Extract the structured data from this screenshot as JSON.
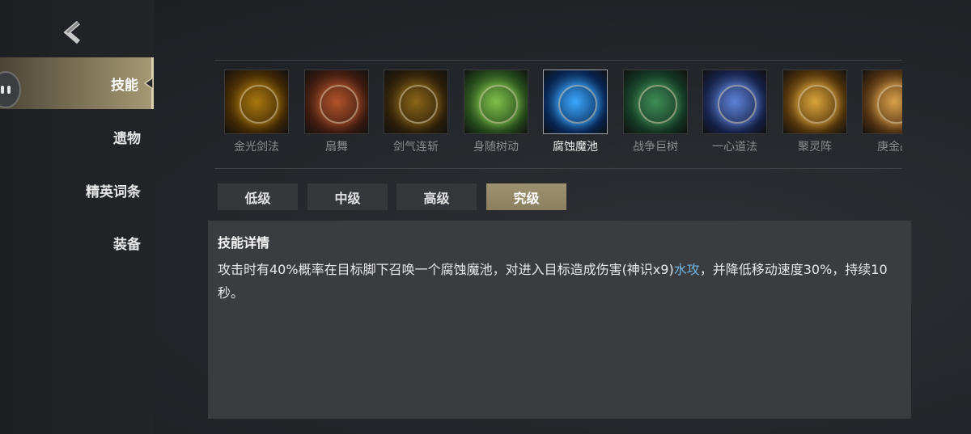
{
  "sidebar": {
    "items": [
      {
        "label": "技能",
        "active": true
      },
      {
        "label": "遗物",
        "active": false
      },
      {
        "label": "精英词条",
        "active": false
      },
      {
        "label": "装备",
        "active": false
      }
    ]
  },
  "skills": [
    {
      "name": "金光剑法",
      "selected": false,
      "colors": [
        "#a8780e",
        "#3b2406"
      ]
    },
    {
      "name": "扇舞",
      "selected": false,
      "colors": [
        "#b2532a",
        "#3a1a10"
      ]
    },
    {
      "name": "剑气连斩",
      "selected": false,
      "colors": [
        "#8a6518",
        "#2a1d0a"
      ]
    },
    {
      "name": "身随树动",
      "selected": false,
      "colors": [
        "#7fc04a",
        "#22451a"
      ]
    },
    {
      "name": "腐蚀魔池",
      "selected": true,
      "colors": [
        "#3aa8ff",
        "#08234f"
      ]
    },
    {
      "name": "战争巨树",
      "selected": false,
      "colors": [
        "#3f8d55",
        "#123221"
      ]
    },
    {
      "name": "一心道法",
      "selected": false,
      "colors": [
        "#5e82d8",
        "#141f44"
      ]
    },
    {
      "name": "聚灵阵",
      "selected": false,
      "colors": [
        "#d9a43a",
        "#4a2e0a"
      ]
    },
    {
      "name": "庚金战",
      "selected": false,
      "colors": [
        "#d8a04a",
        "#4a2c10"
      ]
    }
  ],
  "tiers": [
    {
      "label": "低级",
      "active": false
    },
    {
      "label": "中级",
      "active": false
    },
    {
      "label": "高级",
      "active": false
    },
    {
      "label": "究级",
      "active": true
    }
  ],
  "detail": {
    "title": "技能详情",
    "text_before": "攻击时有40%概率在目标脚下召唤一个腐蚀魔池，对进入目标造成伤害(神识x9)",
    "text_highlight": "水攻",
    "text_after": "，并降低移动速度30%，持续10秒。",
    "highlight_color": "#6fb3de"
  }
}
